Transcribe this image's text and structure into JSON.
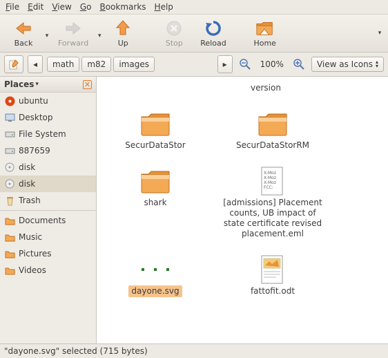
{
  "menu": {
    "file": "File",
    "edit": "Edit",
    "view": "View",
    "go": "Go",
    "bookmarks": "Bookmarks",
    "help": "Help"
  },
  "toolbar": {
    "back": "Back",
    "forward": "Forward",
    "up": "Up",
    "stop": "Stop",
    "reload": "Reload",
    "home": "Home"
  },
  "path": {
    "seg1": "math",
    "seg2": "m82",
    "seg3": "images"
  },
  "zoom": {
    "level": "100%"
  },
  "viewas": {
    "label": "View as Icons"
  },
  "sidebar": {
    "header": "Places",
    "items": [
      {
        "label": "ubuntu"
      },
      {
        "label": "Desktop"
      },
      {
        "label": "File System"
      },
      {
        "label": "887659"
      },
      {
        "label": "disk"
      },
      {
        "label": "disk"
      },
      {
        "label": "Trash"
      }
    ],
    "folders": [
      {
        "label": "Documents"
      },
      {
        "label": "Music"
      },
      {
        "label": "Pictures"
      },
      {
        "label": "Videos"
      }
    ]
  },
  "files": {
    "prev": "version",
    "f1": "SecurDataStor",
    "f2": "SecurDataStorRM",
    "f3": "shark",
    "f4": "[admissions] Placement counts, UB impact of state certificate revised placement.eml",
    "f5": "dayone.svg",
    "f6": "fattofit.odt"
  },
  "status": {
    "text": "\"dayone.svg\" selected (715 bytes)"
  }
}
